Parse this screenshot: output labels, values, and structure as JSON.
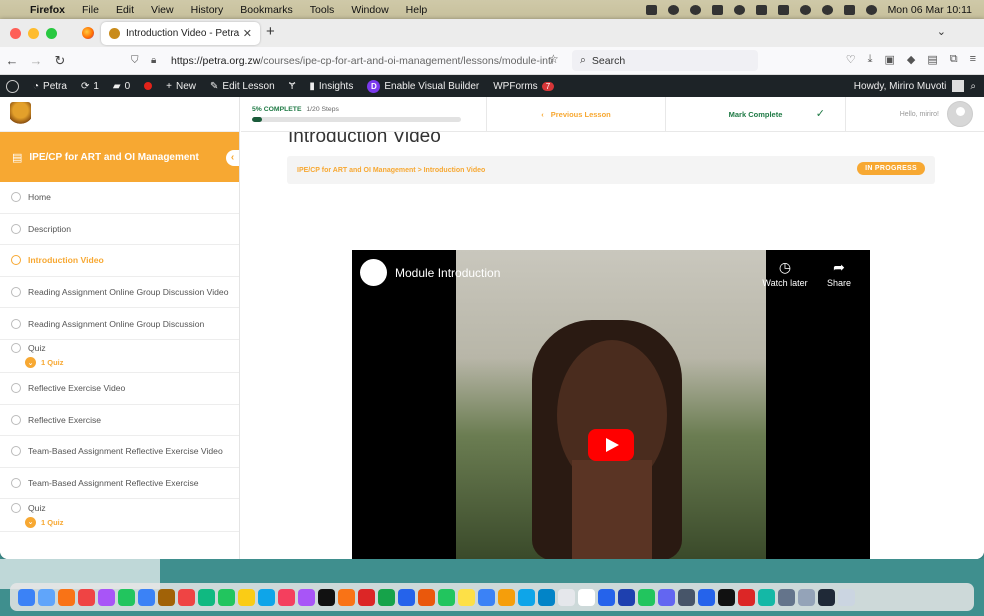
{
  "mac_menu": {
    "app": "Firefox",
    "items": [
      "File",
      "Edit",
      "View",
      "History",
      "Bookmarks",
      "Tools",
      "Window",
      "Help"
    ],
    "clock": "Mon 06 Mar  10:11"
  },
  "browser": {
    "tab_title": "Introduction Video - Petra",
    "url_host": "https://petra.org.zw",
    "url_path": "/courses/ipe-cp-for-art-and-oi-management/lessons/module-intr",
    "search_placeholder": "Search"
  },
  "wp_admin_bar": {
    "site": "Petra",
    "updates": "1",
    "comments": "0",
    "new_label": "New",
    "edit_label": "Edit Lesson",
    "insights_label": "Insights",
    "divi_label": "Enable Visual Builder",
    "wpforms_label": "WPForms",
    "wpforms_badge": "7",
    "howdy": "Howdy, Miriro Muvoti"
  },
  "sidebar": {
    "course_title": "IPE/CP for ART and OI Management",
    "lessons": [
      {
        "label": "Home"
      },
      {
        "label": "Description"
      },
      {
        "label": "Introduction Video"
      },
      {
        "label": "Reading Assignment Online Group Discussion Video"
      },
      {
        "label": "Reading Assignment Online Group Discussion"
      },
      {
        "label": "Quiz",
        "sub": "1 Quiz"
      },
      {
        "label": "Reflective Exercise Video"
      },
      {
        "label": "Reflective Exercise"
      },
      {
        "label": "Team-Based Assignment Reflective Exercise Video"
      },
      {
        "label": "Team-Based Assignment Reflective Exercise"
      },
      {
        "label": "Quiz",
        "sub": "1 Quiz"
      }
    ]
  },
  "header": {
    "progress_label": "5% COMPLETE",
    "steps": "1/20 Steps",
    "progress_value": 0.05,
    "prev_label": "Previous Lesson",
    "mark_label": "Mark Complete",
    "hello": "Hello, miriro!"
  },
  "lesson": {
    "title": "Introduction Video",
    "breadcrumb": "IPE/CP for ART and OI Management > Introduction Video",
    "status": "IN PROGRESS"
  },
  "video": {
    "title": "Module Introduction",
    "watch_later": "Watch later",
    "share": "Share"
  }
}
